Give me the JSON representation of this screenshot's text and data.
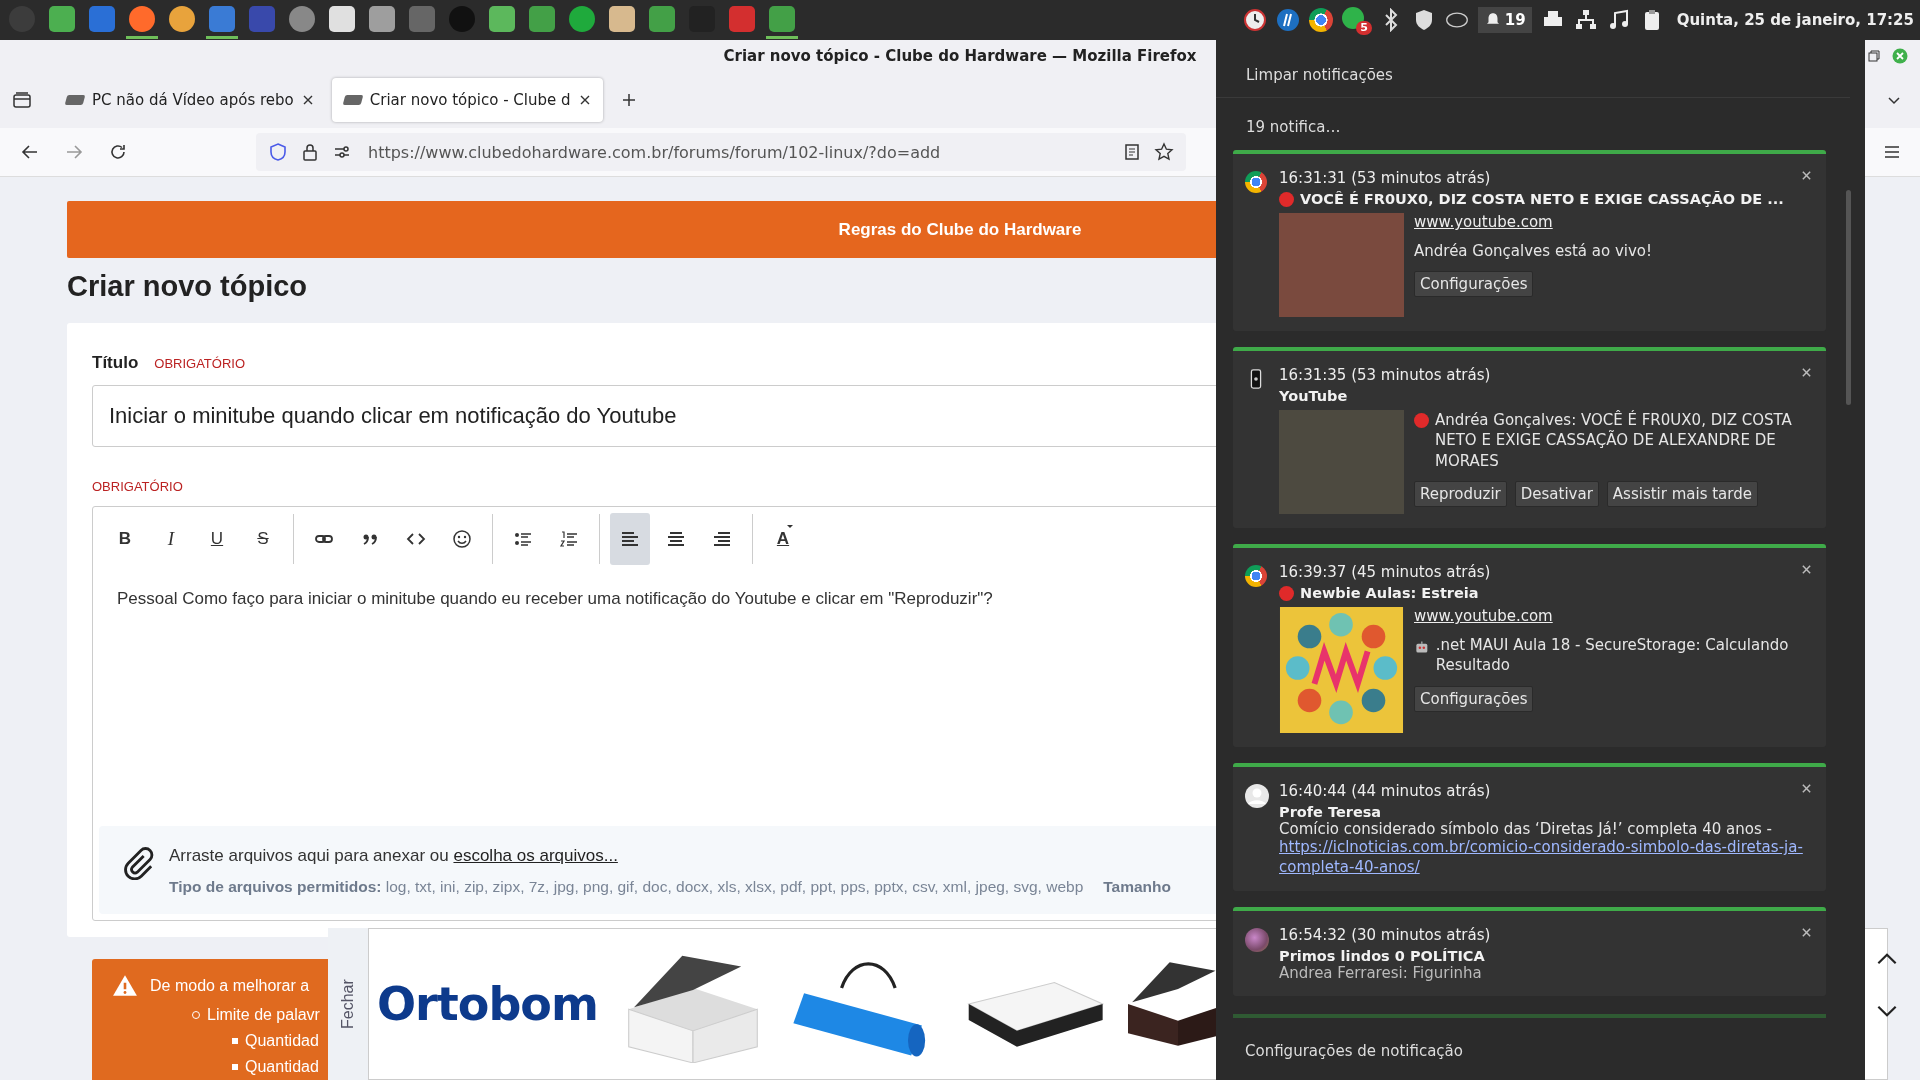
{
  "top_panel": {
    "launchers": [
      {
        "running": false
      },
      {
        "running": false
      },
      {
        "running": false
      },
      {
        "running": true
      },
      {
        "running": false
      },
      {
        "running": true
      },
      {
        "running": false
      },
      {
        "running": false
      },
      {
        "running": false
      },
      {
        "running": false
      },
      {
        "running": false
      },
      {
        "running": false
      },
      {
        "running": false
      },
      {
        "running": false
      },
      {
        "running": false
      },
      {
        "running": false
      },
      {
        "running": false
      },
      {
        "running": false
      },
      {
        "running": false
      },
      {
        "running": true
      }
    ],
    "chat_badge": "5",
    "notification_count": "19",
    "clock": "Quinta, 25 de janeiro, 17:25"
  },
  "window": {
    "title": "Criar novo tópico - Clube do Hardware — Mozilla Firefox"
  },
  "tabs": [
    {
      "label": "PC não dá Vídeo após rebo",
      "selected": false
    },
    {
      "label": "Criar novo tópico - Clube d",
      "selected": true
    }
  ],
  "address_bar": {
    "url": "https://www.clubedohardware.com.br/forums/forum/102-linux/?do=add"
  },
  "page": {
    "rules_banner": "Regras do Clube do Hardware",
    "heading": "Criar novo tópico",
    "title_label": "Título",
    "title_required": "OBRIGATÓRIO",
    "title_value": "Iniciar o minitube quando clicar em notificação do Youtube",
    "content_required": "OBRIGATÓRIO",
    "toolbar": [
      {
        "kind": "bold",
        "glyph": "B",
        "selected": false
      },
      {
        "kind": "italic",
        "glyph": "I",
        "selected": false
      },
      {
        "kind": "underline",
        "glyph": "U",
        "selected": false
      },
      {
        "kind": "strike",
        "glyph": "S",
        "selected": false
      },
      {
        "kind": "link",
        "selected": false
      },
      {
        "kind": "quote",
        "selected": false
      },
      {
        "kind": "code",
        "selected": false
      },
      {
        "kind": "emoji",
        "selected": false
      },
      {
        "kind": "bullets",
        "selected": false
      },
      {
        "kind": "numbers",
        "selected": false
      },
      {
        "kind": "align-left",
        "selected": true
      },
      {
        "kind": "align-center",
        "selected": false
      },
      {
        "kind": "align-right",
        "selected": false
      },
      {
        "kind": "text-color",
        "glyph": "A",
        "selected": false
      }
    ],
    "body": "Pessoal Como faço para iniciar o minitube quando eu receber uma notificação do Youtube e clicar em \"Reproduzir\"?",
    "attach_text": "Arraste arquivos aqui para anexar ou",
    "attach_link": "escolha os arquivos...",
    "file_types": "**Tipo de arquivos permitidos:** log, txt, ini, zip, zipx, 7z, jpg, png, gif, doc, docx, xls, xlsx, pdf, ppt, pps, pptx, csv, xml, jpeg, svg, webp",
    "size_label": "Tamanho",
    "warning": {
      "text": "De modo a melhorar a",
      "items": [
        {
          "text": "Limite de palavr",
          "children": [
            {
              "text": "Quantidad"
            },
            {
              "text": "Quantidad"
            }
          ]
        }
      ]
    },
    "ad": {
      "close_tab": "Fechar",
      "brand": "Ortobom"
    }
  },
  "notifications": {
    "clear": "Limpar notificações",
    "count": "19 notifica…",
    "settings": "Configurações de notificação",
    "items": [
      {
        "time": "16:31:31 (53 minutos atrás)",
        "title": "VOCÊ É FR0UX0, DIZ COSTA NETO E EXIGE CASSAÇÃO DE ...",
        "source": "www.youtube.com",
        "body": "Andréa Gonçalves está ao vivo!",
        "actions": [
          "Configurações"
        ]
      },
      {
        "time": "16:31:35 (53 minutos atrás)",
        "title": "YouTube",
        "body": "Andréa Gonçalves: VOCÊ É FR0UX0, DIZ COSTA NETO E EXIGE CASSAÇÃO DE ALEXANDRE DE MORAES",
        "actions": [
          "Reproduzir",
          "Desativar",
          "Assistir mais tarde"
        ]
      },
      {
        "time": "16:39:37 (45 minutos atrás)",
        "title": "Newbie Aulas: Estreia",
        "source": "www.youtube.com",
        "body": ".net MAUI Aula 18 - SecureStorage: Calculando Resultado",
        "actions": [
          "Configurações"
        ]
      },
      {
        "time": "16:40:44 (44 minutos atrás)",
        "title": "Profe Teresa",
        "body": "Comício considerado símbolo das ‘Diretas Já!’ completa 40 anos -",
        "link": "https://iclnoticias.com.br/comicio-considerado-simbolo-das-diretas-ja-completa-40-anos/"
      },
      {
        "time": "16:54:32 (30 minutos atrás)",
        "title": "Primos lindos 0 POLÍTICA",
        "body": "Andrea Ferraresi: Figurinha"
      }
    ]
  }
}
